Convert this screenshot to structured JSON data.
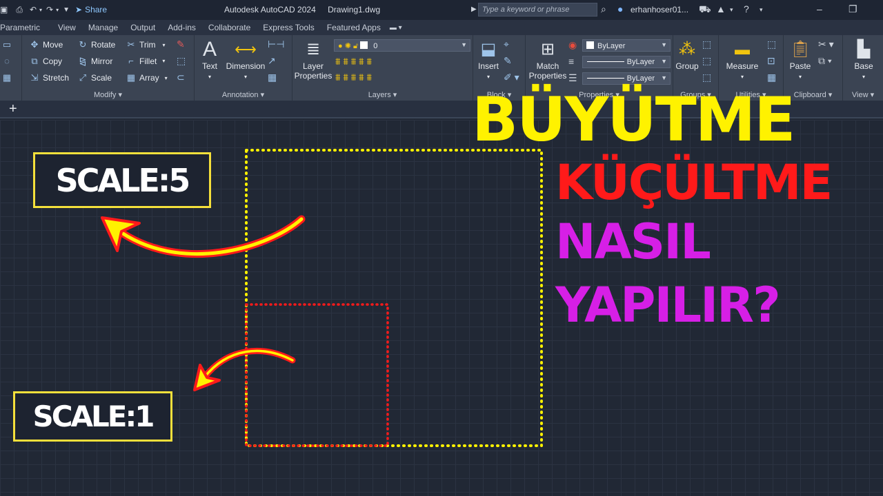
{
  "titlebar": {
    "share_label": "Share",
    "app_title": "Autodesk AutoCAD 2024",
    "file_name": "Drawing1.dwg",
    "search_placeholder": "Type a keyword or phrase",
    "user_name": "erhanhoser01..."
  },
  "tabs": [
    "Parametric",
    "View",
    "Manage",
    "Output",
    "Add-ins",
    "Collaborate",
    "Express Tools",
    "Featured Apps"
  ],
  "ribbon": {
    "modify": {
      "title": "Modify",
      "move": "Move",
      "rotate": "Rotate",
      "trim": "Trim",
      "copy": "Copy",
      "mirror": "Mirror",
      "fillet": "Fillet",
      "stretch": "Stretch",
      "scale": "Scale",
      "array": "Array"
    },
    "annotation": {
      "title": "Annotation",
      "text": "Text",
      "dimension": "Dimension"
    },
    "layers": {
      "title": "Layers",
      "layer_properties_1": "Layer",
      "layer_properties_2": "Properties",
      "current_layer": "0"
    },
    "block": {
      "insert": "Insert",
      "title": "Block"
    },
    "properties": {
      "match_1": "Match",
      "match_2": "Properties",
      "color": "ByLayer",
      "linetype": "ByLayer",
      "lineweight": "ByLayer",
      "title": "Properties"
    },
    "groups": {
      "group": "Group",
      "title": "Groups"
    },
    "utilities": {
      "measure": "Measure",
      "title": "Utilities"
    },
    "clipboard": {
      "paste": "Paste",
      "title": "Clipboard"
    },
    "view": {
      "base": "Base",
      "title": "View"
    }
  },
  "overlay": {
    "scale5": "SCALE:5",
    "scale1": "SCALE:1",
    "line1": "BÜYÜTME",
    "line2": "KÜÇÜLTME",
    "line3": "NASIL",
    "line4": "YAPILIR?"
  },
  "colors": {
    "yellow": "#fff200",
    "red": "#ff1a1a",
    "magenta": "#d61fe6",
    "box_border": "#f5e03b"
  }
}
